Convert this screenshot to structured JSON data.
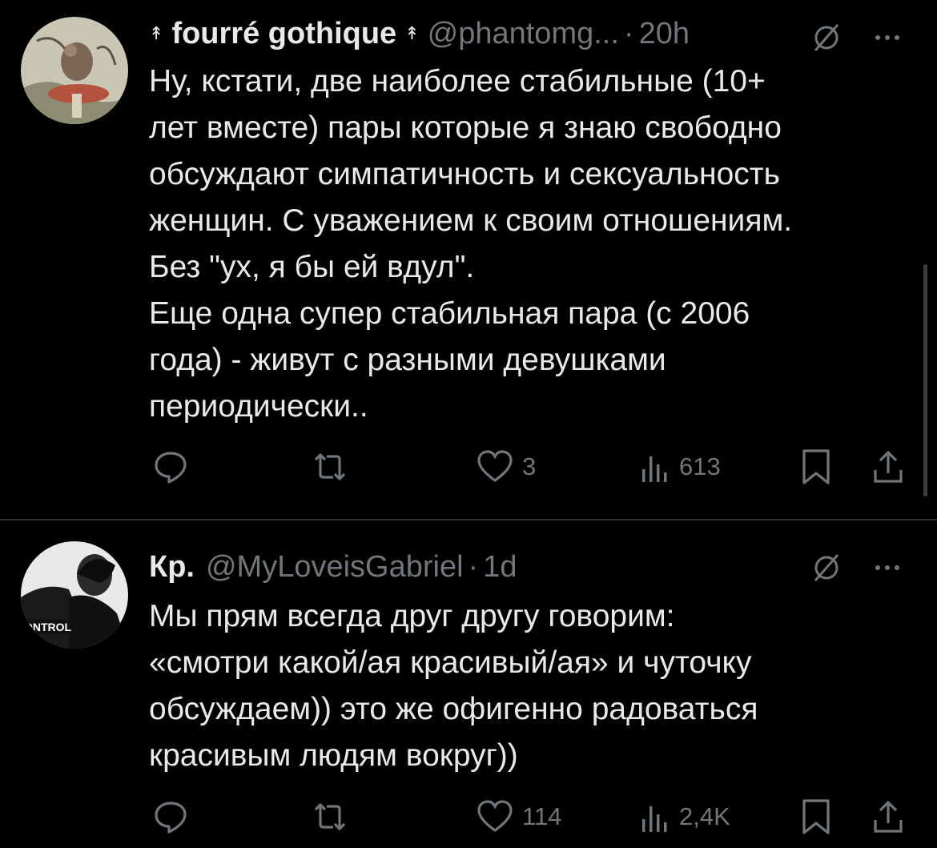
{
  "tweets": [
    {
      "name": "fourré gothique",
      "badge_left": "↟",
      "badge_right": "↟",
      "handle": "@phantomg...",
      "separator": "·",
      "time": "20h",
      "text": "Ну, кстати, две наиболее стабильные (10+\nлет вместе) пары которые я знаю свободно\nобсуждают  симпатичность и сексуальность\nженщин. С уважением к своим отношениям.\nБез \"ух, я бы ей вдул\".\nЕще одна супер стабильная пара (с 2006\nгода) - живут с разными девушками\nпериодически..",
      "likes": "3",
      "views": "613",
      "replies": "",
      "reposts": ""
    },
    {
      "name": "Кр.",
      "handle": "@MyLoveisGabriel",
      "separator": "·",
      "time": "1d",
      "text": "Мы прям всегда друг другу говорим:\n«смотри какой/ая красивый/ая» и чуточку\nобсуждаем)) это же офигенно радоваться\nкрасивым людям вокруг))",
      "avatar_text": "ONTROL",
      "likes": "114",
      "views": "2,4K",
      "replies": "",
      "reposts": ""
    }
  ],
  "icons": {
    "reply": "reply-icon",
    "repost": "repost-icon",
    "like": "heart-icon",
    "views": "views-icon",
    "bookmark": "bookmark-icon",
    "share": "share-icon",
    "grok": "grok-icon",
    "more": "more-icon"
  },
  "colors": {
    "background": "#000000",
    "text": "#e7e9ea",
    "muted": "#71767b",
    "divider": "#2f3336"
  }
}
